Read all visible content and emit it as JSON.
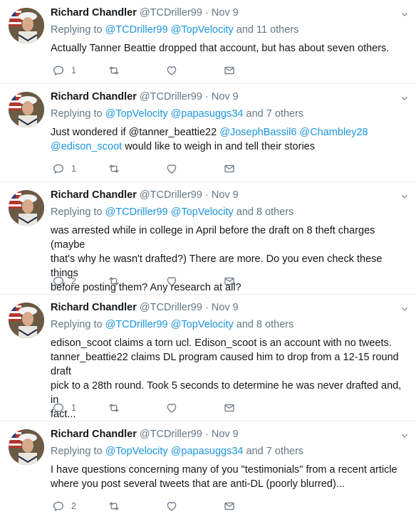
{
  "tweets": [
    {
      "name": "Richard Chandler",
      "handle": "@TCDriller99",
      "dot": "·",
      "time": "Nov 9",
      "replying_prefix": "Replying to ",
      "reply_links": [
        "@TCDriller99",
        "@TopVelocity"
      ],
      "reply_suffix": "and 11 others",
      "text_lines": [
        "Actually Tanner Beattie dropped that account, but has about seven others."
      ],
      "reply_count": "1"
    },
    {
      "name": "Richard Chandler",
      "handle": "@TCDriller99",
      "dot": "·",
      "time": "Nov 9",
      "replying_prefix": "Replying to ",
      "reply_links": [
        "@TopVelocity",
        "@papasuggs34"
      ],
      "reply_suffix": "and 7 others",
      "text_parts": {
        "p1": "Just wondered if @tanner_beattie22 ",
        "l1": "@JosephBassil6",
        "l2": "@Chambley28",
        "l3": "@edison_scoot",
        "p2": " would like to weigh in and tell their stories"
      },
      "reply_count": "1"
    },
    {
      "name": "Richard Chandler",
      "handle": "@TCDriller99",
      "dot": "·",
      "time": "Nov 9",
      "replying_prefix": "Replying to ",
      "reply_links": [
        "@TCDriller99",
        "@TopVelocity"
      ],
      "reply_suffix": "and 8 others",
      "text_lines": [
        "was arrested while in college in April before the draft on 8 theft charges (maybe",
        "that's why he wasn't drafted?) There are more. Do you even check these things",
        "before posting them? Any research at all?"
      ],
      "reply_count": "2"
    },
    {
      "name": "Richard Chandler",
      "handle": "@TCDriller99",
      "dot": "·",
      "time": "Nov 9",
      "replying_prefix": "Replying to ",
      "reply_links": [
        "@TCDriller99",
        "@TopVelocity"
      ],
      "reply_suffix": "and 8 others",
      "text_lines": [
        "edison_scoot claims a torn ucl. Edison_scoot is an account with no tweets.",
        "tanner_beattie22 claims DL program caused him to drop from a 12-15 round draft",
        "pick to a 28th round. Took 5 seconds to determine he was never drafted and, in",
        "fact..."
      ],
      "reply_count": "1"
    },
    {
      "name": "Richard Chandler",
      "handle": "@TCDriller99",
      "dot": "·",
      "time": "Nov 9",
      "replying_prefix": "Replying to ",
      "reply_links": [
        "@TopVelocity",
        "@papasuggs34"
      ],
      "reply_suffix": "and 7 others",
      "text_lines": [
        "I have questions concerning many of you \"testimonials\" from a recent article",
        "where you post several tweets that are anti-DL (poorly blurred)..."
      ],
      "reply_count": "2"
    }
  ],
  "icons": {
    "reply": "reply-icon",
    "retweet": "retweet-icon",
    "like": "heart-icon",
    "dm": "envelope-icon",
    "caret": "chevron-down-icon"
  },
  "colors": {
    "link": "#1b95e0",
    "muted": "#657786",
    "text": "#14171a",
    "divider": "#e6ecf0"
  }
}
